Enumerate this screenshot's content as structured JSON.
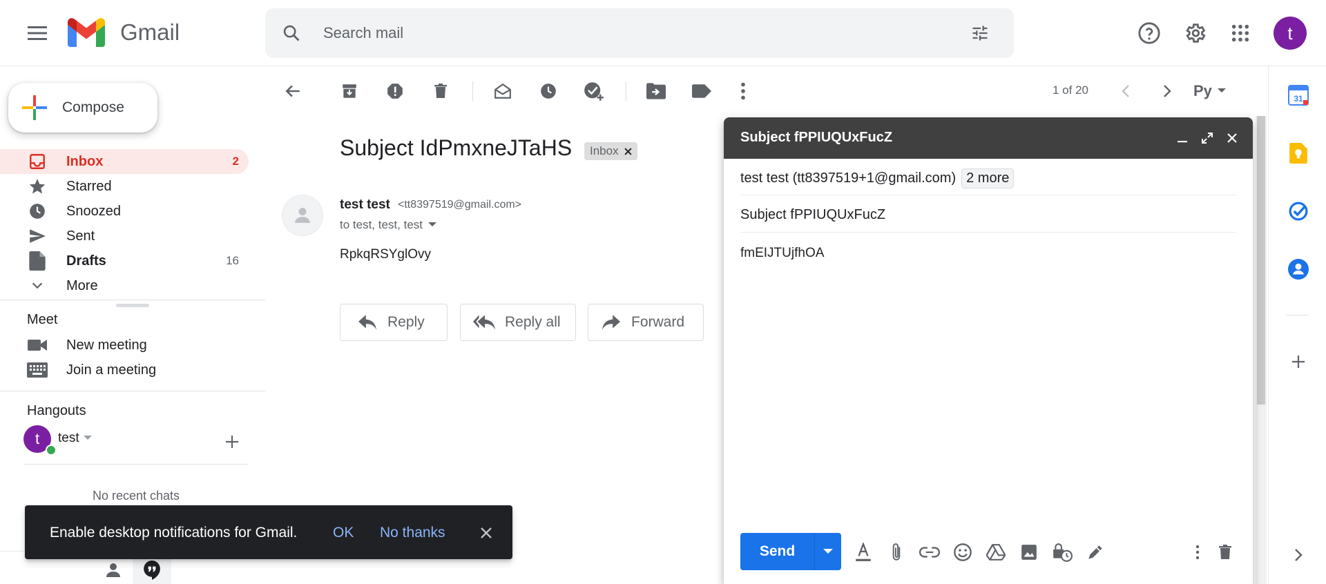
{
  "header": {
    "app_name": "Gmail",
    "search_placeholder": "Search mail",
    "avatar_initial": "t"
  },
  "sidebar": {
    "compose_label": "Compose",
    "items": [
      {
        "label": "Inbox",
        "count": "2",
        "icon": "inbox-icon",
        "active": true
      },
      {
        "label": "Starred",
        "count": "",
        "icon": "star-icon"
      },
      {
        "label": "Snoozed",
        "count": "",
        "icon": "clock-icon"
      },
      {
        "label": "Sent",
        "count": "",
        "icon": "send-icon"
      },
      {
        "label": "Drafts",
        "count": "16",
        "icon": "draft-icon"
      },
      {
        "label": "More",
        "count": "",
        "icon": "chevron-down-icon"
      }
    ],
    "meet": {
      "title": "Meet",
      "new_meeting": "New meeting",
      "join_meeting": "Join a meeting"
    },
    "hangouts": {
      "title": "Hangouts",
      "user": "test",
      "user_initial": "t",
      "no_chats": "No recent chats"
    }
  },
  "toolbar": {
    "pager": "1 of 20",
    "input_tool_label": "Рy"
  },
  "message": {
    "subject": "Subject IdPmxneJTaHS",
    "label_chip": "Inbox",
    "sender_name": "test test",
    "sender_email": "<tt8397519@gmail.com>",
    "to_line": "to test, test, test",
    "body": "RpkqRSYglOvy",
    "reply_label": "Reply",
    "reply_all_label": "Reply all",
    "forward_label": "Forward"
  },
  "compose_window": {
    "title": "Subject fPPIUQUxFucZ",
    "to": "test test (tt8397519+1@gmail.com)",
    "more_recipients": "2 more",
    "subject": "Subject fPPIUQUxFucZ",
    "body": "fmEIJTUjfhOA",
    "send_label": "Send"
  },
  "snackbar": {
    "message": "Enable desktop notifications for Gmail.",
    "ok_label": "OK",
    "no_thanks_label": "No thanks"
  },
  "colors": {
    "accent_blue": "#1a73e8",
    "inbox_red": "#d93025",
    "avatar_purple": "#7b1fa2",
    "compose_header": "#404040",
    "snackbar_bg": "#202124",
    "snackbar_link": "#8ab4f8"
  }
}
